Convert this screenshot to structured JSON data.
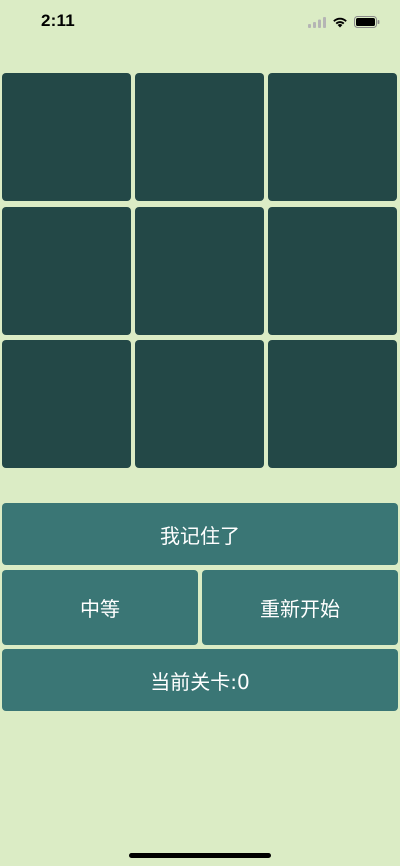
{
  "status_bar": {
    "time": "2:11",
    "icons": [
      "cellular-signal-icon",
      "wifi-icon",
      "battery-icon"
    ]
  },
  "grid": {
    "rows": 3,
    "columns": 3,
    "tile_color": "#234847"
  },
  "buttons": {
    "remember": "我记住了",
    "difficulty": "中等",
    "restart": "重新开始",
    "level": "当前关卡:0"
  },
  "colors": {
    "background": "#dbecc5",
    "tile": "#234847",
    "button": "#3a7675",
    "button_text": "#ffffff"
  }
}
